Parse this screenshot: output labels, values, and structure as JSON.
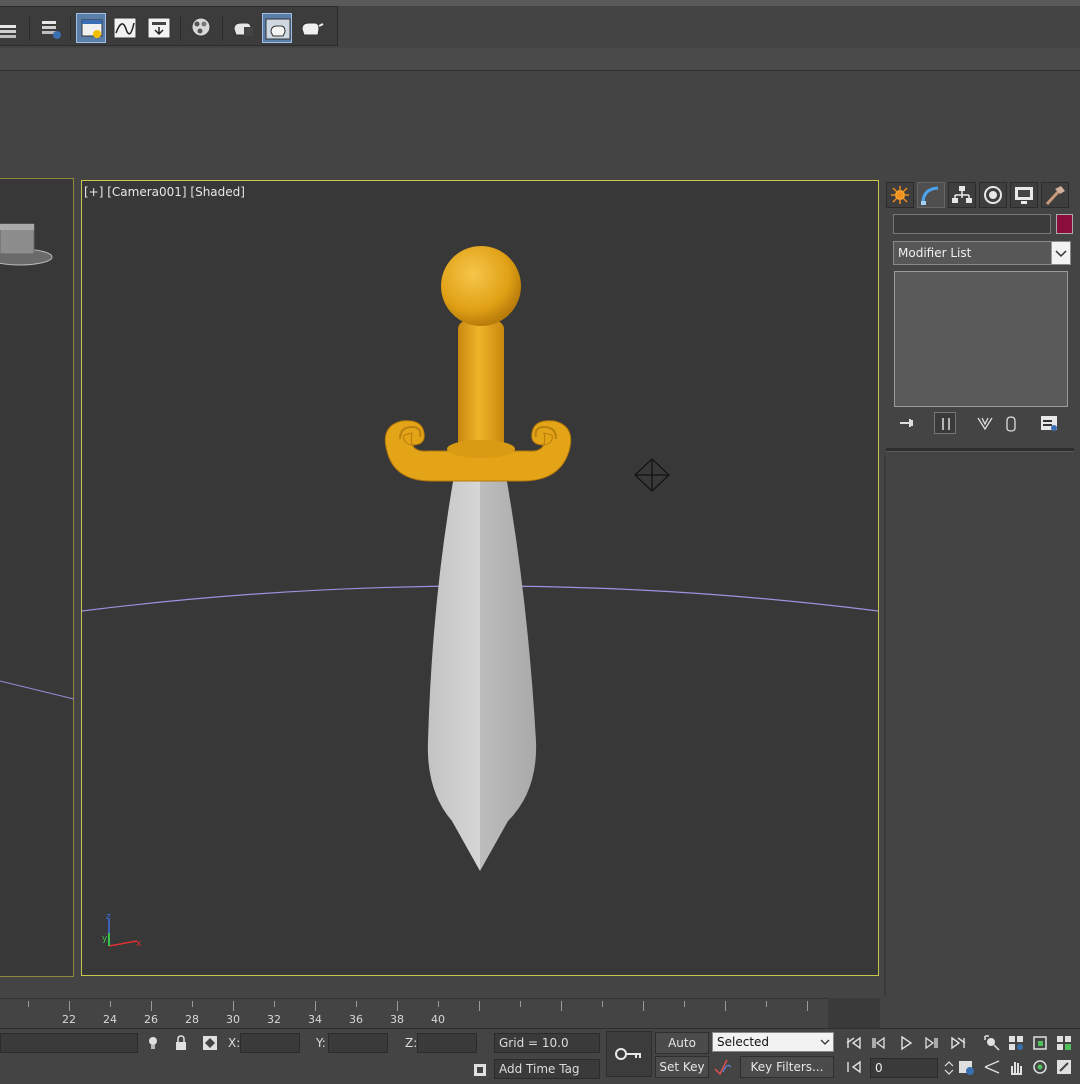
{
  "viewport": {
    "main_label": "[+] [Camera001] [Shaded]"
  },
  "toolbar": {
    "icons": [
      "layer-icon",
      "manage-layers-icon",
      "scene-explorer-icon",
      "curve-editor-icon",
      "schematic-view-icon",
      "material-editor-icon",
      "render-setup-icon",
      "rendered-frame-icon",
      "render-production-icon"
    ]
  },
  "command_panel": {
    "tabs": [
      "create-tab",
      "modify-tab",
      "hierarchy-tab",
      "motion-tab",
      "display-tab",
      "utilities-tab"
    ],
    "object_name": "",
    "color_swatch": "#8a0e3c",
    "modifier_list_label": "Modifier List"
  },
  "timeline": {
    "ticks": [
      "22",
      "24",
      "26",
      "28",
      "30",
      "32",
      "34",
      "36",
      "38",
      "40"
    ]
  },
  "status": {
    "x_label": "X:",
    "y_label": "Y:",
    "z_label": "Z:",
    "x_value": "",
    "y_value": "",
    "z_value": "",
    "grid": "Grid = 10.0",
    "add_time_tag": "Add Time Tag",
    "auto_key": "Auto Key",
    "set_key": "Set Key",
    "selected": "Selected",
    "key_filters": "Key Filters...",
    "frame": "0"
  },
  "colors": {
    "viewport_border": "#c8c84a",
    "hilt_gold": "#e3a417",
    "blade_grey": "#c9c9c9",
    "background": "#383838"
  }
}
